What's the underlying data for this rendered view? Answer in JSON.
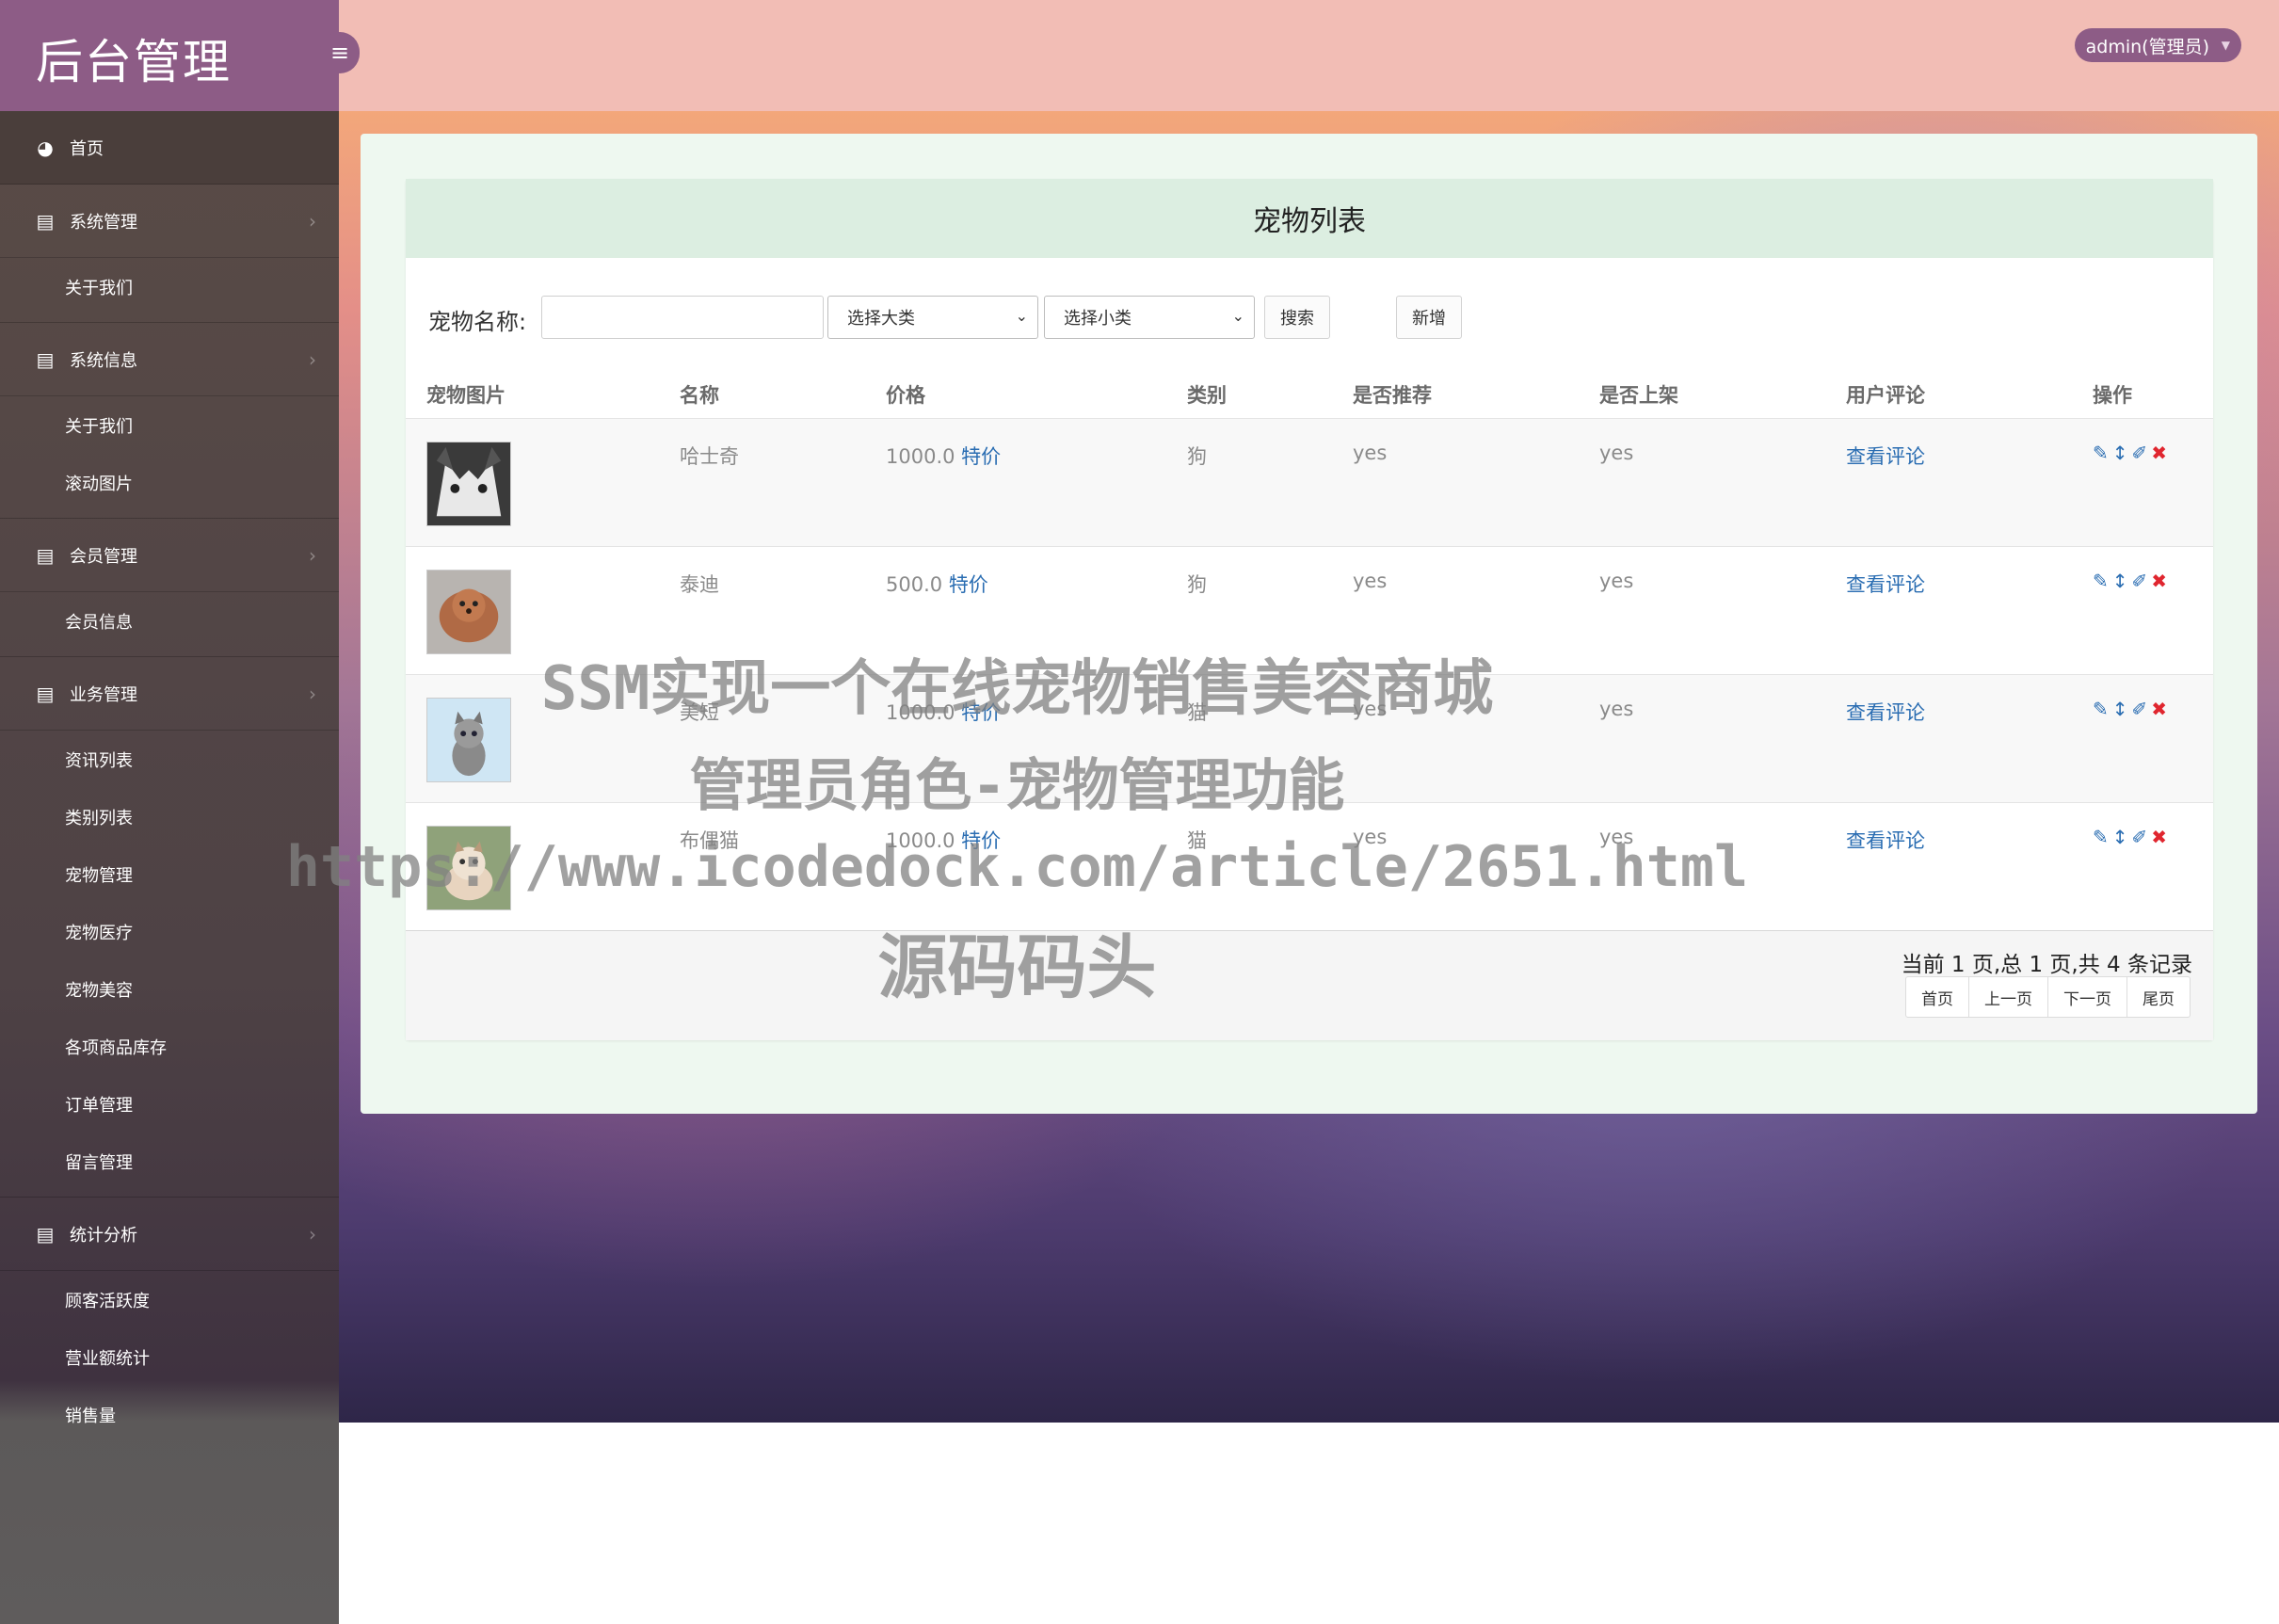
{
  "brand": {
    "title": "后台管理",
    "toggle_icon": "≡"
  },
  "topbar": {
    "user_label": "admin(管理员)"
  },
  "sidebar": {
    "home": "首页",
    "groups": [
      {
        "label": "系统管理",
        "items": [
          "关于我们"
        ]
      },
      {
        "label": "系统信息",
        "items": [
          "关于我们",
          "滚动图片"
        ]
      },
      {
        "label": "会员管理",
        "items": [
          "会员信息"
        ]
      },
      {
        "label": "业务管理",
        "items": [
          "资讯列表",
          "类别列表",
          "宠物管理",
          "宠物医疗",
          "宠物美容",
          "各项商品库存",
          "订单管理",
          "留言管理"
        ]
      },
      {
        "label": "统计分析",
        "items": [
          "顾客活跃度",
          "营业额统计",
          "销售量"
        ]
      }
    ]
  },
  "panel": {
    "title": "宠物列表",
    "search_label": "宠物名称:",
    "search_value": "",
    "select_category": "选择大类",
    "select_subcategory": "选择小类",
    "search_button": "搜索",
    "add_button": "新增"
  },
  "table": {
    "headers": [
      "宠物图片",
      "名称",
      "价格",
      "类别",
      "是否推荐",
      "是否上架",
      "用户评论",
      "操作"
    ],
    "rows": [
      {
        "name": "哈士奇",
        "price": "1000.0",
        "tag": "特价",
        "category": "狗",
        "recommended": "yes",
        "listed": "yes",
        "comments": "查看评论"
      },
      {
        "name": "泰迪",
        "price": "500.0",
        "tag": "特价",
        "category": "狗",
        "recommended": "yes",
        "listed": "yes",
        "comments": "查看评论"
      },
      {
        "name": "美短",
        "price": "1000.0",
        "tag": "特价",
        "category": "猫",
        "recommended": "yes",
        "listed": "yes",
        "comments": "查看评论"
      },
      {
        "name": "布偶猫",
        "price": "1000.0",
        "tag": "特价",
        "category": "猫",
        "recommended": "yes",
        "listed": "yes",
        "comments": "查看评论"
      }
    ]
  },
  "pagination": {
    "info": "当前 1 页,总 1 页,共 4 条记录",
    "buttons": [
      "首页",
      "上一页",
      "下一页",
      "尾页"
    ]
  },
  "watermark": {
    "line1": "SSM实现一个在线宠物销售美容商城",
    "line2": "管理员角色-宠物管理功能",
    "line3": "https://www.icodedock.com/article/2651.html",
    "line4": "源码码头"
  },
  "colors": {
    "accent": "#8d5c86",
    "link": "#2a6db2",
    "delete": "#e0262f",
    "panel_header": "#dceee1"
  }
}
